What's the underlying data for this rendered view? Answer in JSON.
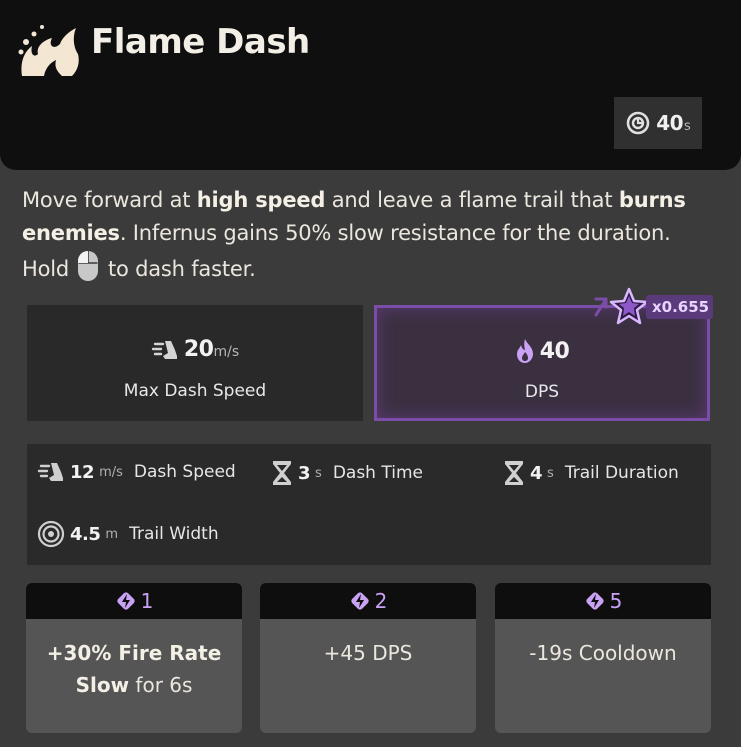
{
  "ability": {
    "name": "Flame Dash",
    "icon": "flame-dash-icon",
    "cooldown": "40",
    "cooldown_unit": "s"
  },
  "description": {
    "p1": "Move forward at ",
    "b1": "high speed",
    "p2": " and leave a flame trail that ",
    "b2": "burns enemies",
    "p3": ". Infernus gains 50% slow resistance for the duration. Hold ",
    "p4": " to dash faster."
  },
  "main_stats": [
    {
      "value": "20",
      "unit": "m/s",
      "label": "Max Dash Speed",
      "icon": "dash-speed-icon"
    },
    {
      "value": "40",
      "unit": "",
      "label": "DPS",
      "icon": "spirit-flame-icon",
      "scaling": "x0.655"
    }
  ],
  "properties": [
    {
      "value": "12",
      "unit": "m/s",
      "label": "Dash Speed",
      "icon": "dash-speed-icon"
    },
    {
      "value": "3",
      "unit": "s",
      "label": "Dash Time",
      "icon": "hourglass-icon"
    },
    {
      "value": "4",
      "unit": "s",
      "label": "Trail Duration",
      "icon": "hourglass-icon"
    },
    {
      "value": "4.5",
      "unit": "m",
      "label": "Trail Width",
      "icon": "radius-icon"
    }
  ],
  "upgrades": [
    {
      "tier": "1",
      "bold1": "+30% Fire Rate",
      "bold2": "Slow",
      "rest": " for 6s"
    },
    {
      "tier": "2",
      "text": "+45 DPS"
    },
    {
      "tier": "5",
      "text": "-19s Cooldown"
    }
  ],
  "colors": {
    "spirit_purple": "#c9a2f5",
    "highlight_border": "#7b4da8",
    "header_bg": "#0f0f0f",
    "panel_bg": "#3b3b3b"
  }
}
